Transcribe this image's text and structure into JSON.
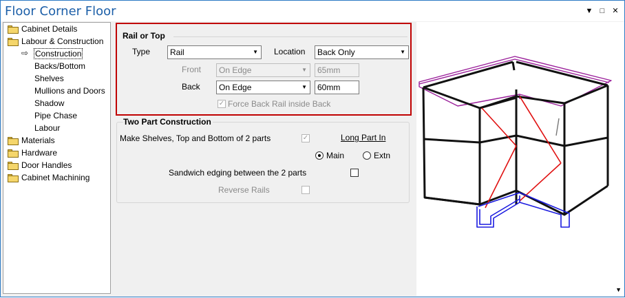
{
  "window": {
    "title": "Floor Corner Floor"
  },
  "tree": {
    "items": [
      {
        "label": "Cabinet Details"
      },
      {
        "label": "Labour & Construction"
      },
      {
        "label": "Materials"
      },
      {
        "label": "Hardware"
      },
      {
        "label": "Door Handles"
      },
      {
        "label": "Cabinet Machining"
      }
    ],
    "children": [
      {
        "label": "Construction"
      },
      {
        "label": "Backs/Bottom"
      },
      {
        "label": "Shelves"
      },
      {
        "label": "Mullions and Doors"
      },
      {
        "label": "Shadow"
      },
      {
        "label": "Pipe Chase"
      },
      {
        "label": "Labour"
      }
    ]
  },
  "rail": {
    "group_title": "Rail or Top",
    "type_label": "Type",
    "type_value": "Rail",
    "location_label": "Location",
    "location_value": "Back Only",
    "front_label": "Front",
    "front_value": "On Edge",
    "front_size": "65mm",
    "back_label": "Back",
    "back_value": "On Edge",
    "back_size": "60mm",
    "force_label": "Force Back Rail inside Back"
  },
  "twopart": {
    "group_title": "Two Part Construction",
    "make_label": "Make Shelves, Top and Bottom of 2 parts",
    "long_part_label": "Long Part In",
    "main_label": "Main",
    "extn_label": "Extn",
    "sandwich_label": "Sandwich edging between the 2 parts",
    "reverse_label": "Reverse Rails"
  },
  "icons": {
    "check": "✓",
    "caret": "▼",
    "pin": "▼",
    "restore": "□",
    "close": "✕",
    "arrow": "⇨"
  },
  "colors": {
    "highlight_border": "#c00000",
    "title": "#1c5fa8",
    "top_frame": "#9a1f9a",
    "bottom_frame": "#1a1ae0",
    "rail_lines": "#e01010"
  }
}
